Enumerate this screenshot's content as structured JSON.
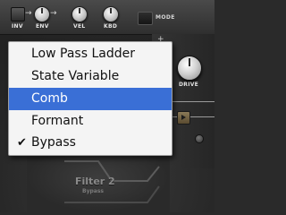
{
  "synth": {
    "labels": {
      "inv": "INV",
      "env": "ENV",
      "vel": "VEL",
      "kbd": "KBD",
      "mode": "MODE",
      "drive": "DRIVE"
    },
    "filter": {
      "title": "Filter 2",
      "subtitle": "Bypass"
    }
  },
  "menu": {
    "items": [
      {
        "label": "Low Pass Ladder",
        "checked": false,
        "highlighted": false
      },
      {
        "label": "State Variable",
        "checked": false,
        "highlighted": false
      },
      {
        "label": "Comb",
        "checked": false,
        "highlighted": true
      },
      {
        "label": "Formant",
        "checked": false,
        "highlighted": false
      },
      {
        "label": "Bypass",
        "checked": true,
        "highlighted": false
      }
    ],
    "check_glyph": "✔",
    "highlight_color": "#3a6fd6"
  },
  "icons": {
    "knob": "knob-icon",
    "arrow": "arrow-right-icon",
    "play": "play-icon",
    "checkmark": "checkmark-icon"
  }
}
